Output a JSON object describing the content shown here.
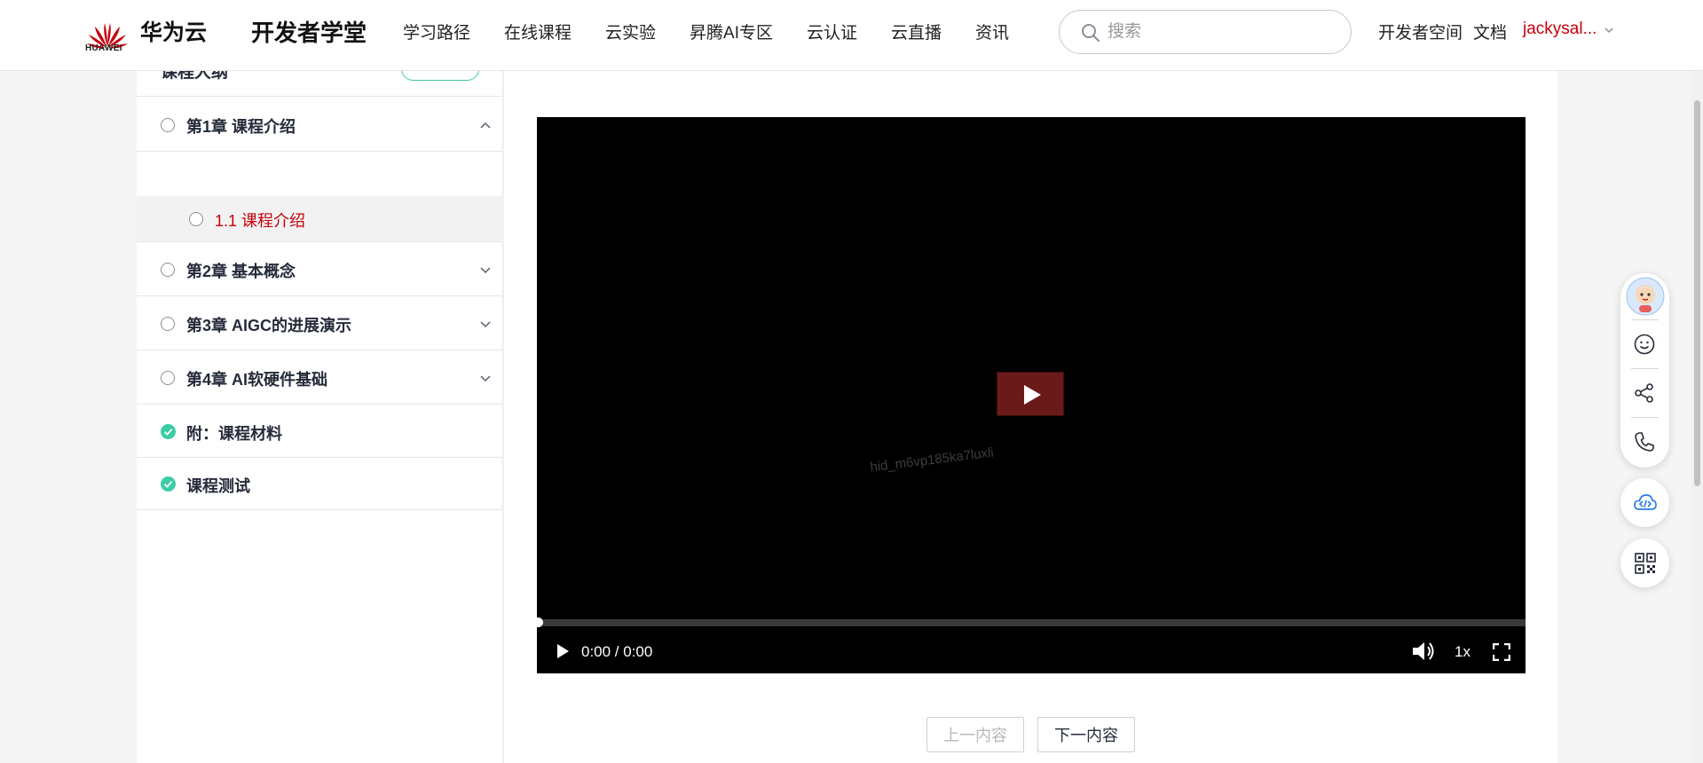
{
  "header": {
    "logo_text": "HUAWEI",
    "brand": "华为云",
    "academy": "开发者学堂",
    "nav": [
      "学习路径",
      "在线课程",
      "云实验",
      "昇腾AI专区",
      "云认证",
      "云直播",
      "资讯"
    ],
    "search_placeholder": "搜索",
    "dev_space": "开发者空间",
    "docs": "文档",
    "user": "jackysal...",
    "brand_color": "#c7000b"
  },
  "sidebar": {
    "top_title": "课程大纲",
    "chapters": [
      {
        "label": "第1章 课程介绍",
        "status": "radio",
        "expanded": true
      },
      {
        "label": "第2章 基本概念",
        "status": "radio",
        "expanded": false
      },
      {
        "label": "第3章 AIGC的进展演示",
        "status": "radio",
        "expanded": false
      },
      {
        "label": "第4章 AI软硬件基础",
        "status": "radio",
        "expanded": false
      },
      {
        "label": "附：课程材料",
        "status": "done"
      },
      {
        "label": "课程测试",
        "status": "done"
      }
    ],
    "section": {
      "label": "1.1 课程介绍"
    },
    "done_color": "#3dcca6"
  },
  "player": {
    "watermark": "hid_m6vp185ka7luxli",
    "time": "0:00 / 0:00",
    "progress": 0,
    "speed": "1x"
  },
  "pager": {
    "prev": "上一内容",
    "next": "下一内容"
  },
  "float_icons": [
    "avatar-icon",
    "smile-icon",
    "share-icon",
    "phone-icon",
    "cloud-code-icon",
    "qr-code-icon"
  ]
}
